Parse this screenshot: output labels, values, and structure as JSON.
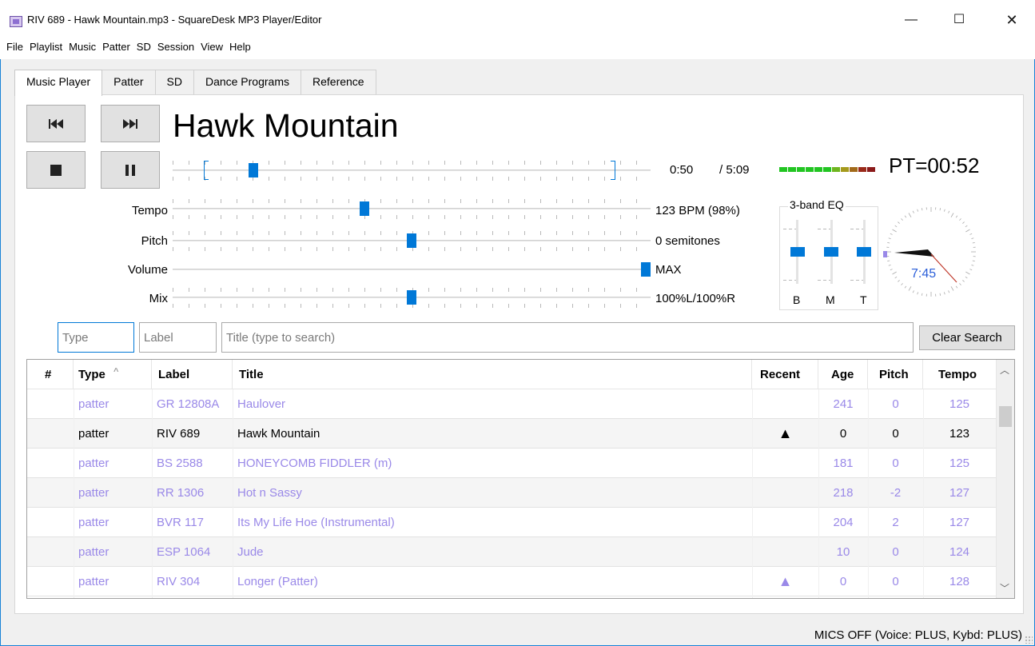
{
  "window": {
    "title": "RIV 689 - Hawk Mountain.mp3 - SquareDesk MP3 Player/Editor",
    "minimize": "—",
    "maximize": "☐",
    "close": "✕"
  },
  "menu": [
    "File",
    "Playlist",
    "Music",
    "Patter",
    "SD",
    "Session",
    "View",
    "Help"
  ],
  "tabs": [
    "Music Player",
    "Patter",
    "SD",
    "Dance Programs",
    "Reference"
  ],
  "player": {
    "song_title": "Hawk Mountain",
    "current_time": "0:50",
    "total_time": "/ 5:09",
    "progress": 0.162,
    "loop_start": 0.066,
    "loop_end": 0.916,
    "pt_timer": "PT=00:52",
    "vu_levels": [
      "#22c522",
      "#22c522",
      "#22c522",
      "#22c522",
      "#22c522",
      "#22c522",
      "#6fb51f",
      "#a59a1c",
      "#a26a1a",
      "#9a2a1a",
      "#8b1a1a"
    ]
  },
  "sliders": {
    "tempo": {
      "label": "Tempo",
      "value": "123 BPM (98%)",
      "position": 0.4
    },
    "pitch": {
      "label": "Pitch",
      "value": "0 semitones",
      "position": 0.5
    },
    "volume": {
      "label": "Volume",
      "value": "MAX",
      "position": 1.0
    },
    "mix": {
      "label": "Mix",
      "value": "100%L/100%R",
      "position": 0.5
    }
  },
  "eq": {
    "title": "3-band EQ",
    "bands": [
      {
        "label": "B",
        "position": 0.5
      },
      {
        "label": "M",
        "position": 0.5
      },
      {
        "label": "T",
        "position": 0.5
      }
    ]
  },
  "clock": {
    "time": "7:45"
  },
  "search": {
    "type_placeholder": "Type",
    "label_placeholder": "Label",
    "title_placeholder": "Title (type to search)",
    "clear_label": "Clear Search"
  },
  "table": {
    "columns": [
      "#",
      "Type",
      "Label",
      "Title",
      "Recent",
      "Age",
      "Pitch",
      "Tempo"
    ],
    "rows": [
      {
        "num": "",
        "type": "patter",
        "label": "GR 12808A",
        "title": "Haulover",
        "recent": "",
        "age": "241",
        "pitch": "0",
        "tempo": "125",
        "state": "dim"
      },
      {
        "num": "",
        "type": "patter",
        "label": "RIV 689",
        "title": "Hawk Mountain",
        "recent": "▲",
        "age": "0",
        "pitch": "0",
        "tempo": "123",
        "state": "sel"
      },
      {
        "num": "",
        "type": "patter",
        "label": "BS 2588",
        "title": "HONEYCOMB FIDDLER (m)",
        "recent": "",
        "age": "181",
        "pitch": "0",
        "tempo": "125",
        "state": "dim"
      },
      {
        "num": "",
        "type": "patter",
        "label": "RR 1306",
        "title": "Hot n Sassy",
        "recent": "",
        "age": "218",
        "pitch": "-2",
        "tempo": "127",
        "state": "dim"
      },
      {
        "num": "",
        "type": "patter",
        "label": "BVR 117",
        "title": "Its My Life Hoe (Instrumental)",
        "recent": "",
        "age": "204",
        "pitch": "2",
        "tempo": "127",
        "state": "dim"
      },
      {
        "num": "",
        "type": "patter",
        "label": "ESP 1064",
        "title": "Jude",
        "recent": "",
        "age": "10",
        "pitch": "0",
        "tempo": "124",
        "state": "dim"
      },
      {
        "num": "",
        "type": "patter",
        "label": "RIV 304",
        "title": "Longer (Patter)",
        "recent": "▲",
        "age": "0",
        "pitch": "0",
        "tempo": "128",
        "state": "dim"
      }
    ]
  },
  "status": {
    "text": "MICS OFF (Voice: PLUS, Kybd: PLUS)"
  }
}
